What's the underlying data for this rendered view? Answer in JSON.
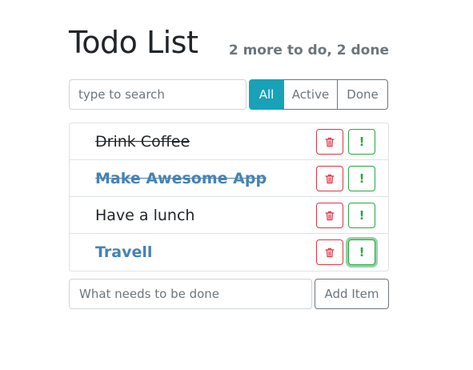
{
  "header": {
    "title": "Todo List",
    "status": "2 more to do, 2 done"
  },
  "search": {
    "placeholder": "type to search",
    "value": ""
  },
  "filters": [
    {
      "label": "All",
      "active": true
    },
    {
      "label": "Active",
      "active": false
    },
    {
      "label": "Done",
      "active": false
    }
  ],
  "todos": [
    {
      "label": "Drink Coffee",
      "done": true,
      "important": false
    },
    {
      "label": "Make Awesome App",
      "done": true,
      "important": true
    },
    {
      "label": "Have a lunch",
      "done": false,
      "important": false
    },
    {
      "label": "Travell",
      "done": false,
      "important": true
    }
  ],
  "add_form": {
    "placeholder": "What needs to be done",
    "value": "",
    "button_label": "Add Item"
  },
  "icons": {
    "delete": "trash-icon",
    "important": "exclamation-icon"
  },
  "colors": {
    "accent": "#17a2b8",
    "danger": "#dc3545",
    "success": "#28a745",
    "important_text": "#4682b4",
    "muted": "#6c757d"
  }
}
